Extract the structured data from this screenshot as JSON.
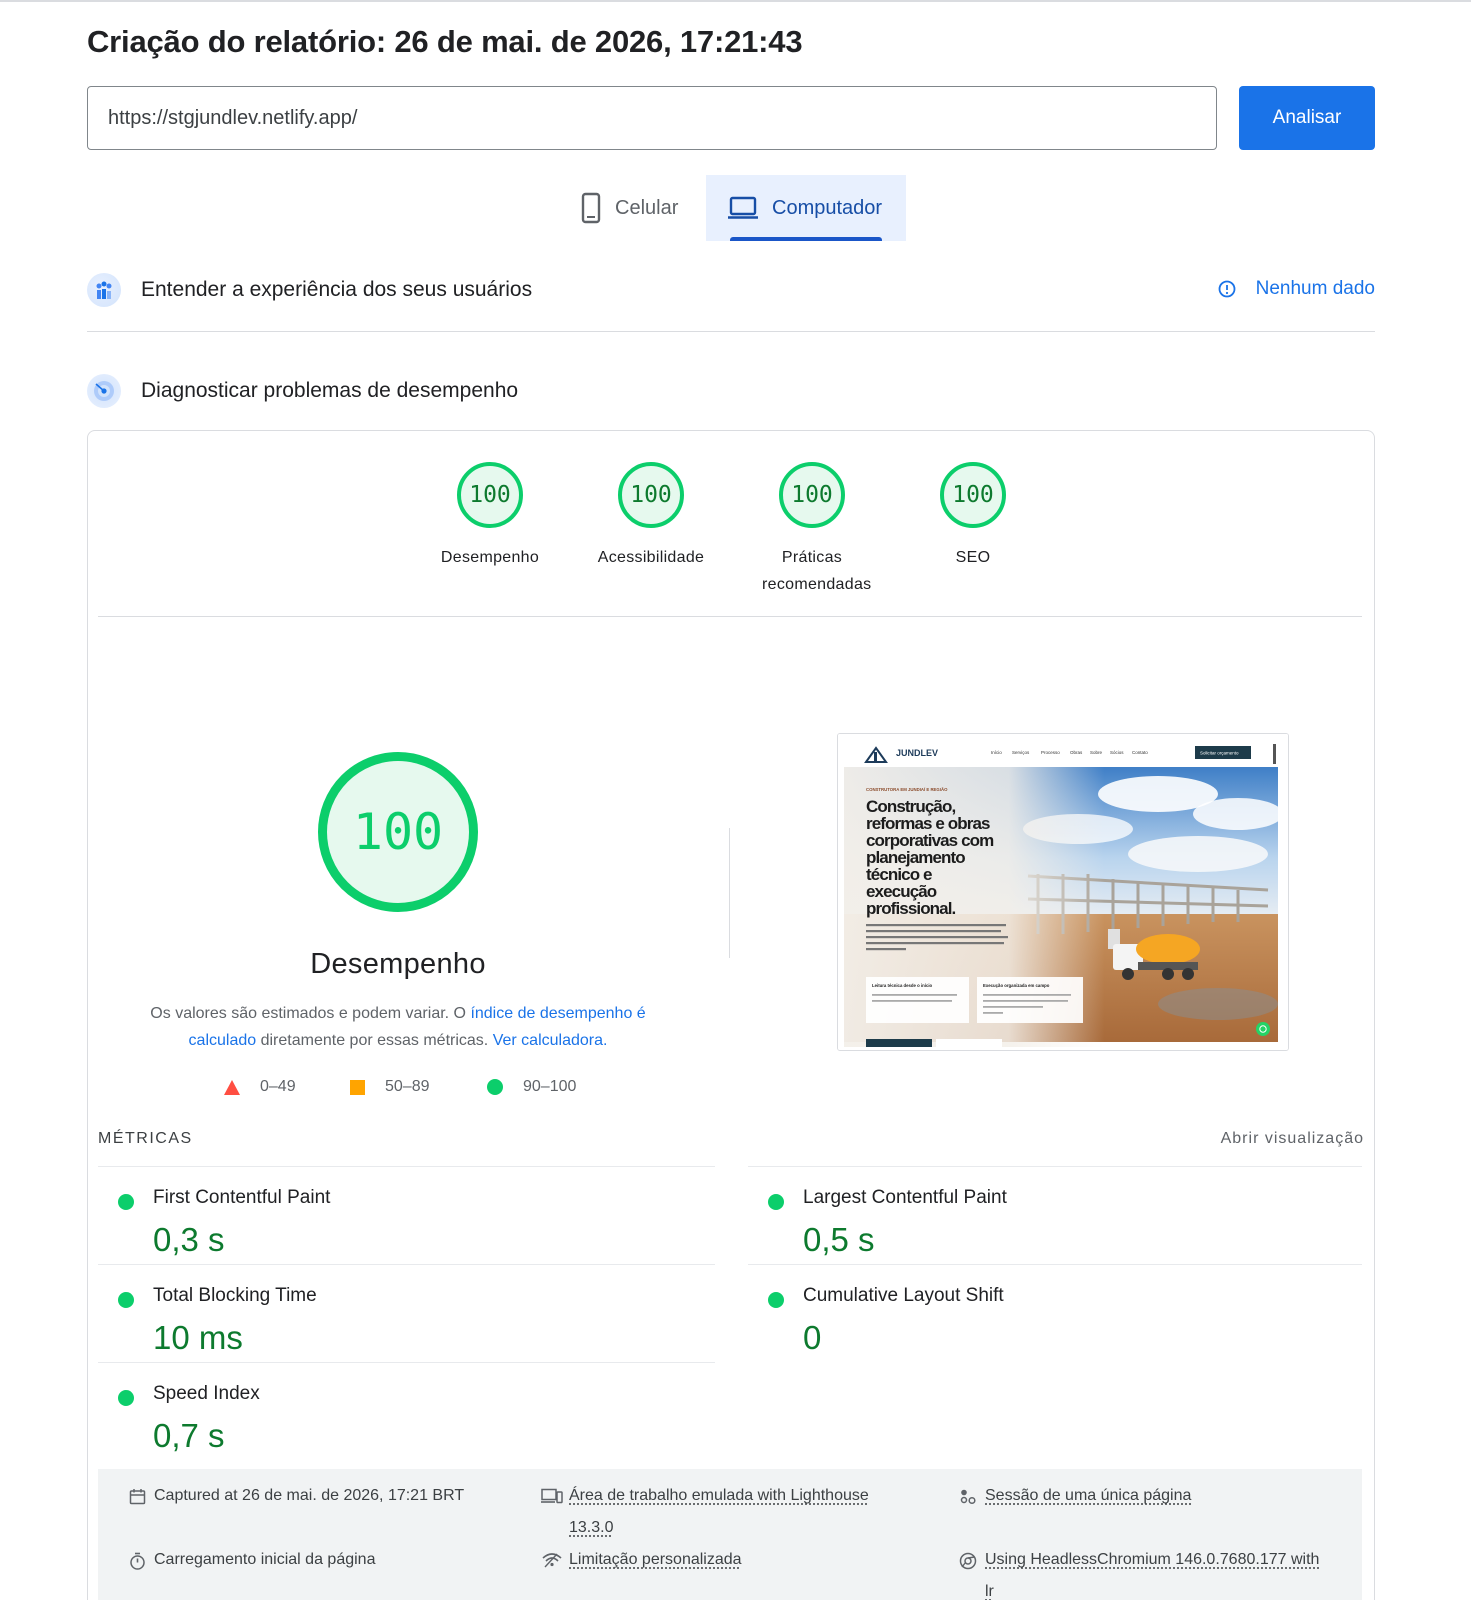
{
  "report": {
    "title": "Criação do relatório: 26 de mai. de 2026, 17:21:43"
  },
  "search": {
    "url_value": "https://stgjundlev.netlify.app/",
    "analyze_label": "Analisar"
  },
  "tabs": [
    {
      "label": "Celular",
      "icon": "smartphone-icon",
      "selected": false
    },
    {
      "label": "Computador",
      "icon": "laptop-icon",
      "selected": true
    }
  ],
  "user_experience": {
    "title": "Entender a experiência dos seus usuários",
    "no_data_label": "Nenhum dado",
    "icon": "users-chart-icon"
  },
  "diagnose": {
    "title": "Diagnosticar problemas de desempenho",
    "icon": "radar-icon"
  },
  "categories": [
    {
      "score": "100",
      "label": "Desempenho"
    },
    {
      "score": "100",
      "label": "Acessibilidade"
    },
    {
      "score": "100",
      "label": "Práticas recomendadas"
    },
    {
      "score": "100",
      "label": "SEO"
    }
  ],
  "performance": {
    "score": "100",
    "title": "Desempenho",
    "desc_part1": "Os valores são estimados e podem variar. O ",
    "desc_link1": "índice de desempenho é calculado",
    "desc_part2": " diretamente por essas métricas. ",
    "desc_link2": "Ver calculadora."
  },
  "legend": [
    {
      "range": "0–49",
      "color": "#ff4e42"
    },
    {
      "range": "50–89",
      "color": "#ffa400"
    },
    {
      "range": "90–100",
      "color": "#0cce6b"
    }
  ],
  "screenshot": {
    "brand": "JUNDLEV",
    "nav": [
      "Início",
      "Serviços",
      "Processo",
      "Obras",
      "Sobre",
      "Sócios",
      "Contato"
    ],
    "cta": "Solicitar orçamento",
    "kicker": "CONSTRUTORA EM JUNDIAÍ E REGIÃO",
    "headline": [
      "Construção,",
      "reformas e obras",
      "corporativas com",
      "planejamento",
      "técnico e",
      "execução",
      "profissional."
    ],
    "card1": "Leitura técnica desde o início",
    "card2": "Execução organizada em campo"
  },
  "metrics": {
    "heading": "MÉTRICAS",
    "open_view": "Abrir visualização",
    "items": [
      {
        "name": "First Contentful Paint",
        "value": "0,3 s"
      },
      {
        "name": "Largest Contentful Paint",
        "value": "0,5 s"
      },
      {
        "name": "Total Blocking Time",
        "value": "10 ms"
      },
      {
        "name": "Cumulative Layout Shift",
        "value": "0"
      },
      {
        "name": "Speed Index",
        "value": "0,7 s"
      }
    ]
  },
  "footer": {
    "captured": "Captured at 26 de mai. de 2026, 17:21 BRT",
    "emulated_1": "Área de trabalho emulada with Lighthouse",
    "emulated_2": "13.3.0",
    "session": "Sessão de uma única página",
    "initial_load": "Carregamento inicial da página",
    "throttling": "Limitação personalizada",
    "browser_1": "Using HeadlessChromium 146.0.7680.177 with",
    "browser_2": "lr"
  },
  "colors": {
    "pass": "#0cce6b",
    "pass_text": "#0d7a2e",
    "accent": "#1a73e8"
  }
}
